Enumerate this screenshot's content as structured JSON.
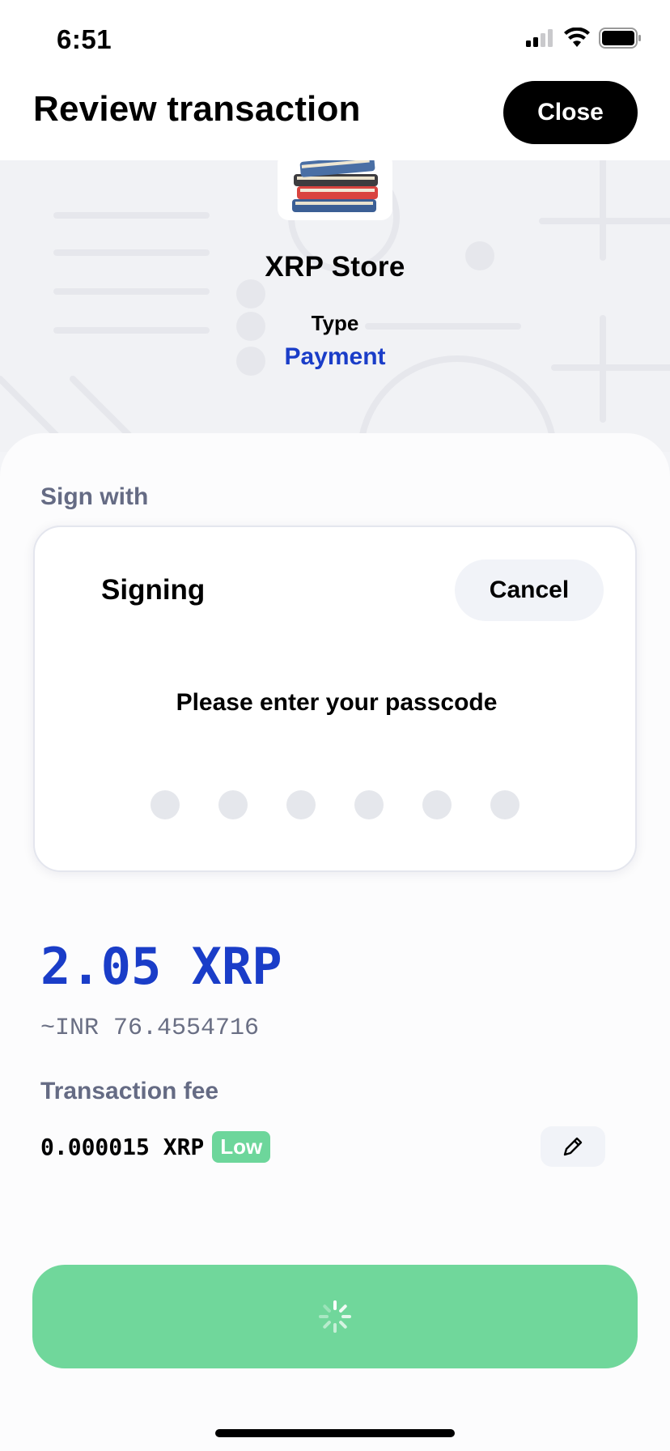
{
  "status_bar": {
    "time": "6:51"
  },
  "header": {
    "title": "Review transaction",
    "close_label": "Close"
  },
  "app": {
    "name": "XRP Store",
    "type_label": "Type",
    "type_value": "Payment"
  },
  "sign_with_label": "Sign with",
  "signing_dialog": {
    "title": "Signing",
    "cancel_label": "Cancel",
    "prompt": "Please enter your passcode",
    "passcode_length": 6,
    "entered_digits": 0
  },
  "amount": {
    "value": "2.05 XRP",
    "fiat": "~INR 76.4554716"
  },
  "fee": {
    "label": "Transaction fee",
    "value": "0.000015 XRP",
    "level": "Low"
  },
  "colors": {
    "accent_blue": "#1a3dc8",
    "success_green": "#70d79b",
    "badge_green": "#6dd69b"
  },
  "icons": {
    "app_icon": "books-icon",
    "edit": "pencil-icon",
    "loading": "spinner-icon"
  }
}
